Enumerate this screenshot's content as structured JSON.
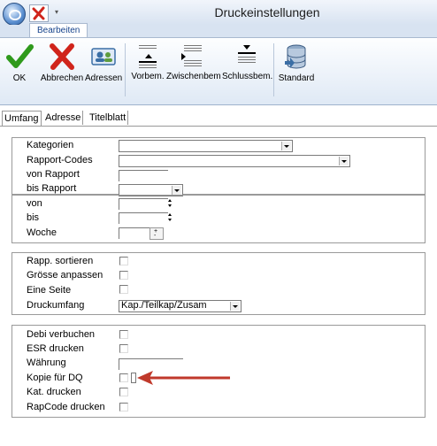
{
  "window": {
    "title": "Druckeinstellungen"
  },
  "ribbon": {
    "tab": "Bearbeiten",
    "buttons": {
      "ok": "OK",
      "abbrechen": "Abbrechen",
      "adressen": "Adressen",
      "vorbem": "Vorbem.",
      "zwischenbem": "Zwischenbem",
      "schlussbem": "Schlussbem.",
      "standard": "Standard"
    }
  },
  "tabs": [
    "Umfang",
    "Adresse",
    "Titelblatt"
  ],
  "form": {
    "kategorien": "Kategorien",
    "rapport_codes": "Rapport-Codes",
    "von_rapport": "von Rapport",
    "bis_rapport": "bis Rapport",
    "von": "von",
    "bis": "bis",
    "woche": "Woche",
    "rapp_sortieren": "Rapp. sortieren",
    "groesse_anpassen": "Grösse anpassen",
    "eine_seite": "Eine Seite",
    "druckumfang": "Druckumfang",
    "druckumfang_value": "Kap./Teilkap/Zusam",
    "debi_verbuchen": "Debi verbuchen",
    "esr_drucken": "ESR drucken",
    "waehrung": "Währung",
    "kopie_fuer_dq": "Kopie für DQ",
    "kat_drucken": "Kat. drucken",
    "rapcode_drucken": "RapCode drucken"
  },
  "colors": {
    "annotation_arrow": "#c0392b",
    "ribbon_text": "#15428b"
  }
}
